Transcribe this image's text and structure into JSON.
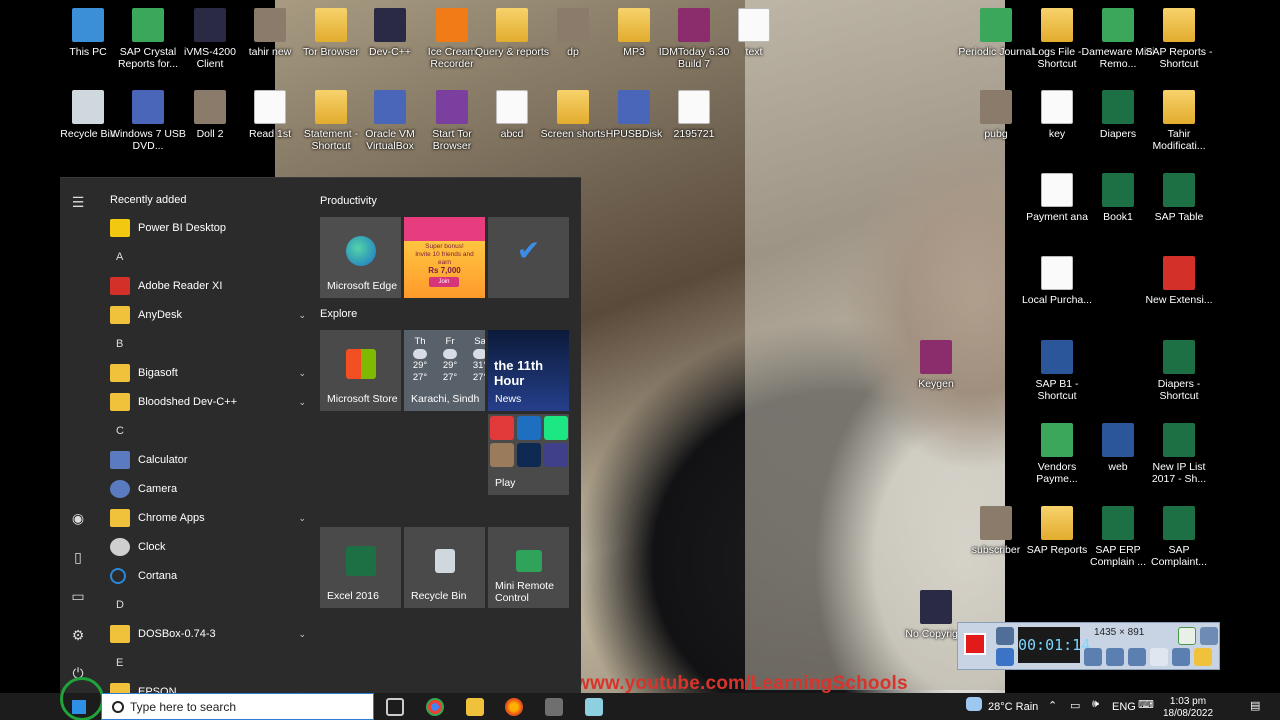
{
  "desktop": {
    "top_row": [
      {
        "label": "This PC",
        "icon": "this-pc-icon"
      },
      {
        "label": "SAP Crystal Reports for...",
        "icon": "sap-crystal-icon"
      },
      {
        "label": "iVMS-4200 Client",
        "icon": "ivms-icon"
      },
      {
        "label": "tahir new",
        "icon": "photo-icon"
      },
      {
        "label": "Tor Browser",
        "icon": "folder-icon"
      },
      {
        "label": "Dev-C++",
        "icon": "devcpp-icon"
      },
      {
        "label": "Ice Cream Recorder",
        "icon": "icecream-icon"
      },
      {
        "label": "Query & reports",
        "icon": "folder-icon"
      },
      {
        "label": "dp",
        "icon": "photo-icon"
      },
      {
        "label": "MP3",
        "icon": "folder-icon"
      },
      {
        "label": "IDMToday 6.30 Build 7",
        "icon": "winrar-icon"
      },
      {
        "label": "text",
        "icon": "text-file-icon"
      }
    ],
    "second_row": [
      {
        "label": "Recycle Bin",
        "icon": "recycle-bin-icon"
      },
      {
        "label": "Windows 7 USB DVD...",
        "icon": "windows-usb-icon"
      },
      {
        "label": "Doll 2",
        "icon": "photo-icon"
      },
      {
        "label": "Read 1st",
        "icon": "text-file-icon"
      },
      {
        "label": "Statement - Shortcut",
        "icon": "folder-shortcut-icon"
      },
      {
        "label": "Oracle VM VirtualBox",
        "icon": "virtualbox-icon"
      },
      {
        "label": "Start Tor Browser",
        "icon": "tor-icon"
      },
      {
        "label": "abcd",
        "icon": "text-file-icon"
      },
      {
        "label": "Screen shorts",
        "icon": "folder-icon"
      },
      {
        "label": "HPUSBDisk",
        "icon": "usb-disk-icon"
      },
      {
        "label": "2195721",
        "icon": "text-file-icon"
      }
    ],
    "right_column": [
      {
        "label": "Periodic Journal",
        "icon": "shortcut-icon"
      },
      {
        "label": "Logs File - Shortcut",
        "icon": "folder-shortcut-icon"
      },
      {
        "label": "Dameware Mini Remo...",
        "icon": "dameware-icon"
      },
      {
        "label": "SAP Reports - Shortcut",
        "icon": "folder-shortcut-icon"
      },
      {
        "label": "pubg",
        "icon": "photo-icon"
      },
      {
        "label": "key",
        "icon": "text-file-icon"
      },
      {
        "label": "Diapers",
        "icon": "excel-icon"
      },
      {
        "label": "Tahir Modificati...",
        "icon": "folder-shortcut-icon"
      },
      {
        "label": "Payment ana",
        "icon": "text-file-icon"
      },
      {
        "label": "Book1",
        "icon": "excel-icon"
      },
      {
        "label": "SAP Table",
        "icon": "excel-icon"
      },
      {
        "label": "Local Purcha...",
        "icon": "text-file-icon"
      },
      {
        "label": "New Extensi...",
        "icon": "pdf-icon"
      },
      {
        "label": "Keygen",
        "icon": "winrar-icon"
      },
      {
        "label": "SAP B1 - Shortcut",
        "icon": "word-icon"
      },
      {
        "label": "Diapers - Shortcut",
        "icon": "excel-icon"
      },
      {
        "label": "Vendors Payme...",
        "icon": "shortcut-icon"
      },
      {
        "label": "web",
        "icon": "word-icon"
      },
      {
        "label": "New IP List 2017 - Sh...",
        "icon": "excel-icon"
      },
      {
        "label": "subscriber",
        "icon": "photo-icon"
      },
      {
        "label": "SAP Reports",
        "icon": "folder-icon"
      },
      {
        "label": "SAP ERP Complain ...",
        "icon": "excel-icon"
      },
      {
        "label": "SAP Complaint...",
        "icon": "excel-icon"
      },
      {
        "label": "No Copyrig...",
        "icon": "video-icon"
      }
    ]
  },
  "start_menu": {
    "recently_added": "Recently added",
    "apps": [
      {
        "label": "Power BI Desktop",
        "icon": "powerbi-icon",
        "color": "#f2c811"
      },
      {
        "letter": "A"
      },
      {
        "label": "Adobe Reader XI",
        "icon": "adobe-icon",
        "color": "#d4302a"
      },
      {
        "label": "AnyDesk",
        "icon": "folder-icon",
        "color": "#f0c23b",
        "expand": true
      },
      {
        "letter": "B"
      },
      {
        "label": "Bigasoft",
        "icon": "folder-icon",
        "color": "#f0c23b",
        "expand": true
      },
      {
        "label": "Bloodshed Dev-C++",
        "icon": "folder-icon",
        "color": "#f0c23b",
        "expand": true
      },
      {
        "letter": "C"
      },
      {
        "label": "Calculator",
        "icon": "calculator-icon",
        "color": "#5a7bbf"
      },
      {
        "label": "Camera",
        "icon": "camera-icon",
        "color": "#5a7bbf"
      },
      {
        "label": "Chrome Apps",
        "icon": "folder-icon",
        "color": "#f0c23b",
        "expand": true
      },
      {
        "label": "Clock",
        "icon": "clock-icon",
        "color": "#cfcfcf"
      },
      {
        "label": "Cortana",
        "icon": "cortana-icon",
        "color": "#2b88d8"
      },
      {
        "letter": "D"
      },
      {
        "label": "DOSBox-0.74-3",
        "icon": "folder-icon",
        "color": "#f0c23b",
        "expand": true
      },
      {
        "letter": "E"
      },
      {
        "label": "EPSON",
        "icon": "folder-icon",
        "color": "#f0c23b",
        "expand": true
      }
    ],
    "groups": {
      "productivity": "Productivity",
      "explore": "Explore"
    },
    "tiles": {
      "edge": "Microsoft Edge",
      "store": "Microsoft Store",
      "weather_city": "Karachi, Sindh",
      "news": "News",
      "play": "Play",
      "excel": "Excel 2016",
      "recycle": "Recycle Bin",
      "mini_remote": "Mini Remote Control",
      "news_headline": "the 11th Hour"
    },
    "weather": [
      {
        "day": "Th",
        "high": "29°",
        "low": "27°"
      },
      {
        "day": "Fr",
        "high": "29°",
        "low": "27°"
      },
      {
        "day": "Sa",
        "high": "31°",
        "low": "27°"
      }
    ],
    "promo": {
      "line1": "Super bonus!",
      "line2": "Invite 10 friends and earn",
      "amount": "Rs 7,000",
      "button": "Join"
    }
  },
  "recorder": {
    "time": "00:01:14",
    "dims": "1435 × 891"
  },
  "watermark": "www.youtube.com/LearningSchools",
  "taskbar": {
    "search_placeholder": "Type here to search",
    "weather": "28°C  Rain",
    "language": "ENG",
    "time": "1:03 pm",
    "date": "18/08/2022"
  }
}
